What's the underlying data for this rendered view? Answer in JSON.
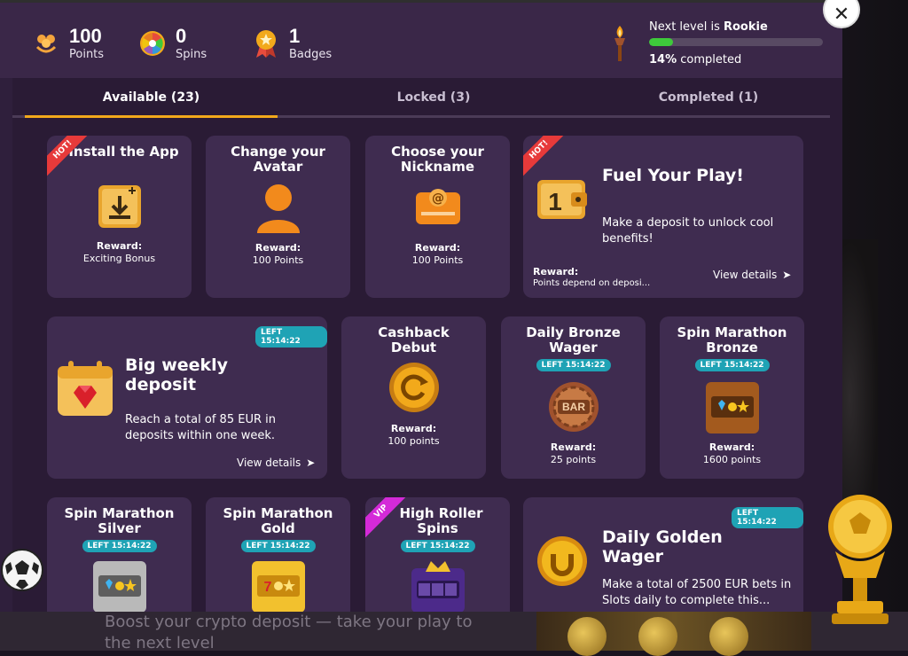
{
  "stats": {
    "points": {
      "value": "100",
      "label": "Points"
    },
    "spins": {
      "value": "0",
      "label": "Spins"
    },
    "badges": {
      "value": "1",
      "label": "Badges"
    }
  },
  "level": {
    "prefix": "Next level is ",
    "name": "Rookie",
    "progress_pct": 14,
    "completed_value": "14%",
    "completed_suffix": " completed"
  },
  "tabs": [
    {
      "label": "Available (23)",
      "active": true
    },
    {
      "label": "Locked (3)",
      "active": false
    },
    {
      "label": "Completed (1)",
      "active": false
    }
  ],
  "cards": {
    "install_app": {
      "title": "Install the App",
      "ribbon": "HOT!",
      "reward_label": "Reward:",
      "reward_value": "Exciting Bonus"
    },
    "avatar": {
      "title_l1": "Change your",
      "title_l2": "Avatar",
      "reward_label": "Reward:",
      "reward_value": "100 Points"
    },
    "nickname": {
      "title_l1": "Choose your",
      "title_l2": "Nickname",
      "reward_label": "Reward:",
      "reward_value": "100 Points"
    },
    "fuel": {
      "title": "Fuel Your Play!",
      "ribbon": "HOT!",
      "desc": "Make a deposit to unlock cool benefits!",
      "reward_label": "Reward:",
      "reward_value": "Points depend on deposi...",
      "view": "View details"
    },
    "weekly": {
      "title_l1": "Big weekly",
      "title_l2": "deposit",
      "badge": "LEFT 15:14:22",
      "desc": "Reach a total of 85 EUR in deposits within one week.",
      "view": "View details"
    },
    "cashback": {
      "title_l1": "Cashback",
      "title_l2": "Debut",
      "reward_label": "Reward:",
      "reward_value": "100 points"
    },
    "bronze_wager": {
      "title_l1": "Daily Bronze",
      "title_l2": "Wager",
      "badge": "LEFT 15:14:22",
      "icon_text": "BAR",
      "reward_label": "Reward:",
      "reward_value": "25 points"
    },
    "spin_bronze": {
      "title_l1": "Spin Marathon",
      "title_l2": "Bronze",
      "badge": "LEFT 15:14:22",
      "reward_label": "Reward:",
      "reward_value": "1600 points"
    },
    "spin_silver": {
      "title_l1": "Spin Marathon",
      "title_l2": "Silver",
      "badge": "LEFT 15:14:22"
    },
    "spin_gold": {
      "title_l1": "Spin Marathon",
      "title_l2": "Gold",
      "badge": "LEFT 15:14:22"
    },
    "high_roller": {
      "title_l1": "High Roller",
      "title_l2": "Spins",
      "ribbon": "VIP",
      "badge": "LEFT 15:14:22"
    },
    "golden_wager": {
      "title_l1": "Daily Golden",
      "title_l2": "Wager",
      "badge": "LEFT 15:14:22",
      "desc": "Make a total of 2500 EUR bets in Slots daily to complete this..."
    }
  },
  "bottom": {
    "text": "Boost your crypto deposit — take your play to the next level"
  },
  "colors": {
    "accent": "#f2a91b",
    "progress": "#3ec93b",
    "badge": "#1fa3b5",
    "hot": "#e73a3a",
    "vip": "#d42ad8",
    "card": "#3f2c50"
  }
}
